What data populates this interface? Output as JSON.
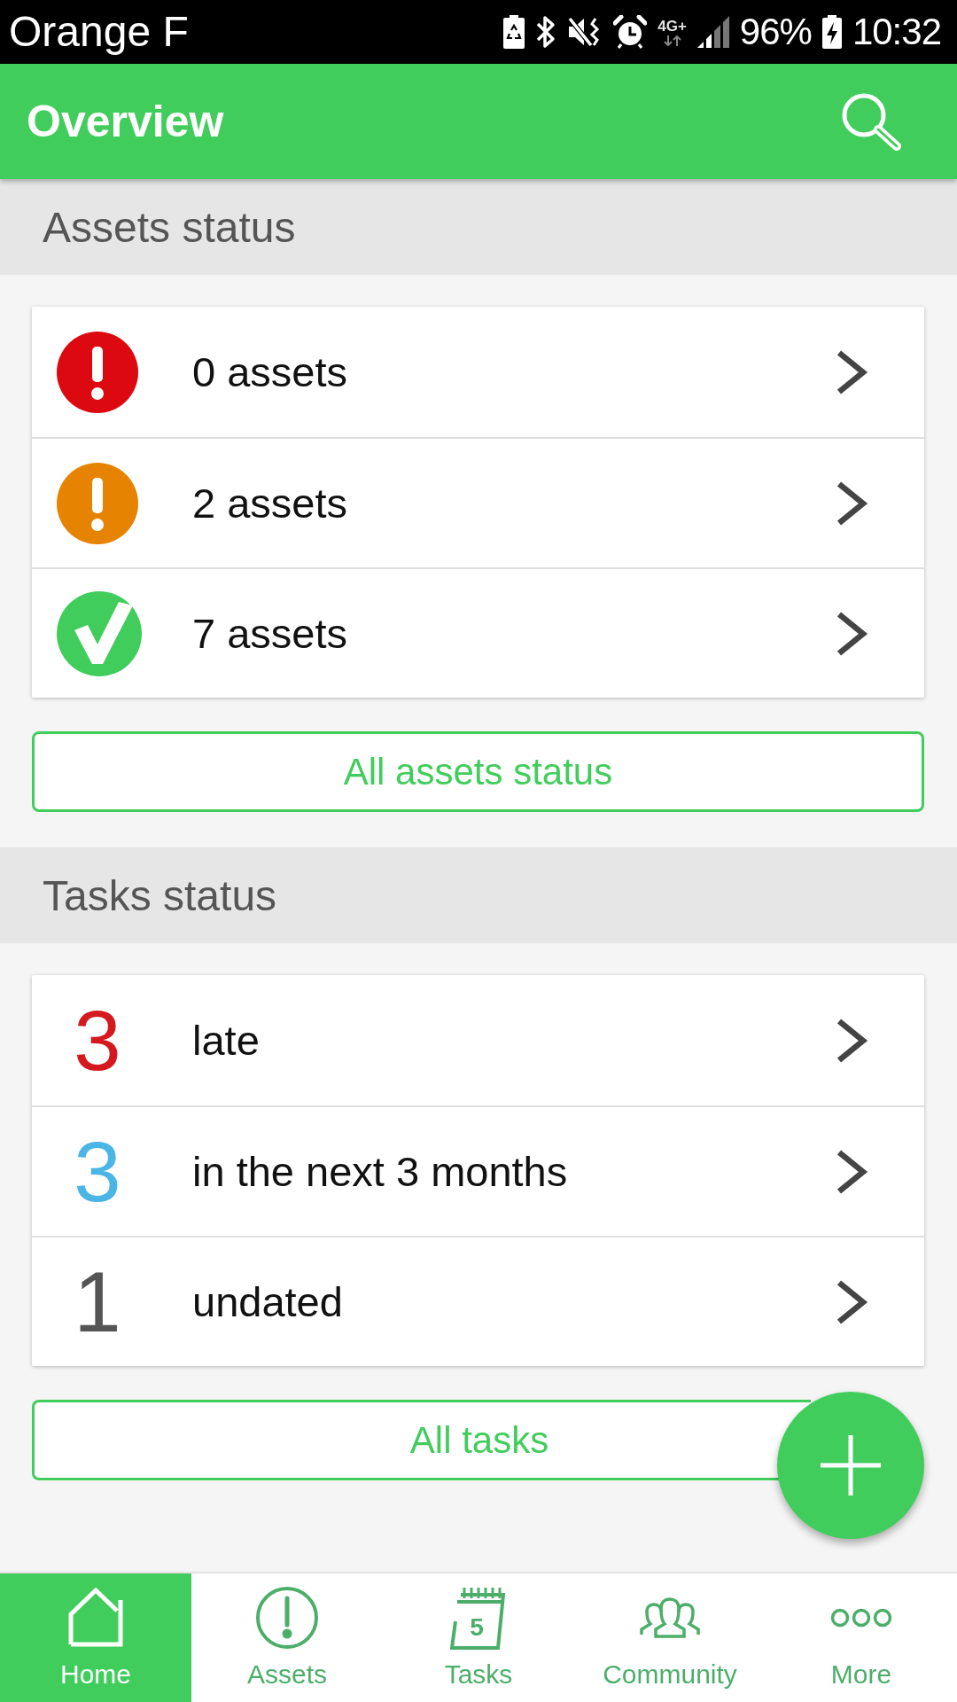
{
  "status_bar": {
    "carrier": "Orange F",
    "network": "4G+",
    "battery": "96%",
    "time": "10:32"
  },
  "app_bar": {
    "title": "Overview"
  },
  "sections": [
    {
      "title": "Assets status",
      "rows": [
        {
          "kind": "warning",
          "color": "#dc0a10",
          "label": "0 assets"
        },
        {
          "kind": "warning",
          "color": "#e68300",
          "label": "2 assets"
        },
        {
          "kind": "ok",
          "color": "#41cd5c",
          "label": "7 assets"
        }
      ],
      "button": "All assets status"
    },
    {
      "title": "Tasks status",
      "rows": [
        {
          "kind": "count",
          "count": "3",
          "color": "#d41a1f",
          "label": "late"
        },
        {
          "kind": "count",
          "count": "3",
          "color": "#4bb5e6",
          "label": "in the next 3 months"
        },
        {
          "kind": "count",
          "count": "1",
          "color": "#555555",
          "label": "undated"
        }
      ],
      "button": "All tasks"
    }
  ],
  "bottom_nav": [
    {
      "kind": "home",
      "label": "Home",
      "selected": true
    },
    {
      "kind": "assets",
      "label": "Assets",
      "selected": false
    },
    {
      "kind": "tasks",
      "label": "Tasks",
      "selected": false,
      "icon_text": "5"
    },
    {
      "kind": "community",
      "label": "Community",
      "selected": false
    },
    {
      "kind": "more",
      "label": "More",
      "selected": false
    }
  ]
}
